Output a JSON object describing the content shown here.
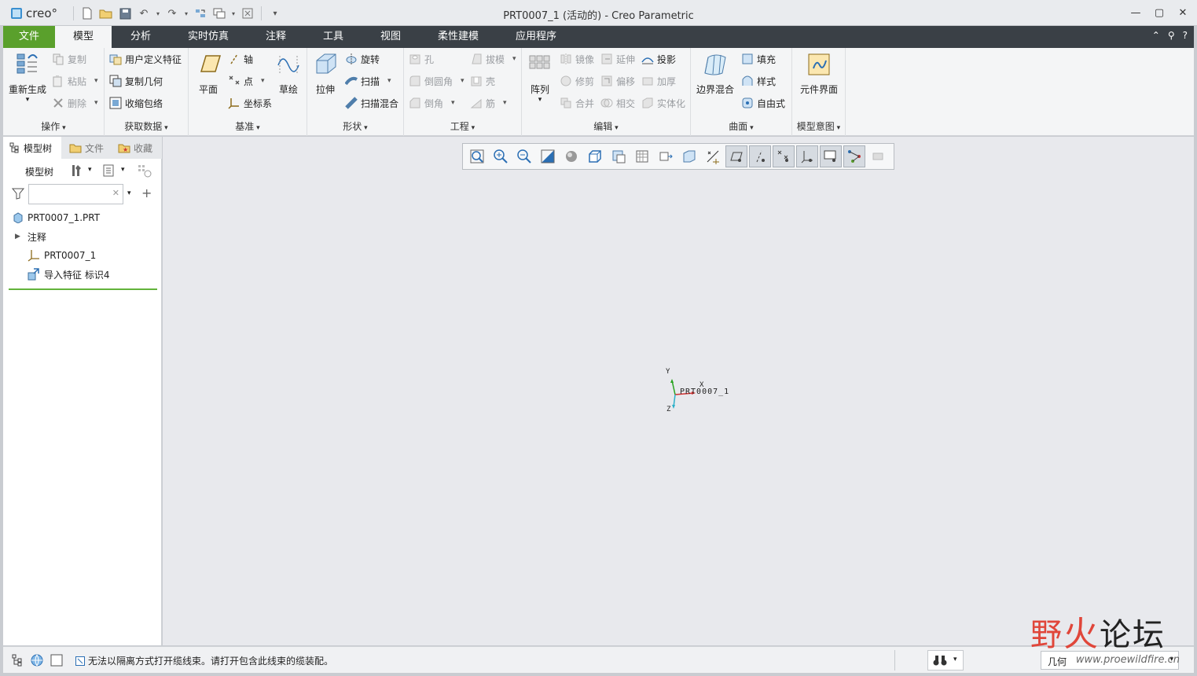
{
  "app": {
    "logo_text": "creo°",
    "window_title": "PRT0007_1 (活动的) - Creo Parametric"
  },
  "tabs": [
    "文件",
    "模型",
    "分析",
    "实时仿真",
    "注释",
    "工具",
    "视图",
    "柔性建模",
    "应用程序"
  ],
  "ribbon": {
    "ops": {
      "label": "操作",
      "regen": "重新生成",
      "copy": "复制",
      "paste": "粘贴",
      "delete": "删除"
    },
    "getdata": {
      "label": "获取数据",
      "udf": "用户定义特征",
      "copygeom": "复制几何",
      "shrinkwrap": "收缩包络"
    },
    "datum": {
      "label": "基准",
      "plane": "平面",
      "axis": "轴",
      "point": "点",
      "csys": "坐标系",
      "sketch": "草绘"
    },
    "shapes": {
      "label": "形状",
      "extrude": "拉伸",
      "revolve": "旋转",
      "sweep": "扫描",
      "sweptblend": "扫描混合"
    },
    "eng": {
      "label": "工程",
      "hole": "孔",
      "round": "倒圆角",
      "chamfer": "倒角",
      "draft": "拔模",
      "shell": "壳",
      "rib": "筋"
    },
    "edit": {
      "label": "编辑",
      "pattern": "阵列",
      "mirror": "镜像",
      "extend": "延伸",
      "project": "投影",
      "trim": "修剪",
      "offset": "偏移",
      "thicken": "加厚",
      "merge": "合并",
      "intersect": "相交",
      "solidify": "实体化"
    },
    "surface": {
      "label": "曲面",
      "boundary": "边界混合",
      "fill": "填充",
      "style": "样式",
      "freestyle": "自由式"
    },
    "intent": {
      "label": "模型意图",
      "component_interface": "元件界面"
    }
  },
  "left_panel": {
    "tabs": [
      "模型树",
      "文件",
      "收藏"
    ],
    "tree_label": "模型树",
    "search_placeholder": "",
    "items": [
      "PRT0007_1.PRT",
      "注释",
      "PRT0007_1",
      "导入特征 标识4"
    ]
  },
  "graphics": {
    "csys_label": "PRT0007_1",
    "axis_x": "X",
    "axis_y": "Y",
    "axis_z": "Z"
  },
  "status": {
    "message": "无法以隔离方式打开缆线束。请打开包含此线束的缆装配。",
    "filter_value": "几何"
  },
  "watermark": {
    "text_a": "野",
    "text_b": "火",
    "text_c": "论坛",
    "url": "www.proewildfire.cn"
  },
  "colors": {
    "file_tab": "#5aa02c",
    "tabbar": "#3a4046",
    "tree_separator": "#62b33b",
    "graphics_bg": "#e8e9ed"
  }
}
